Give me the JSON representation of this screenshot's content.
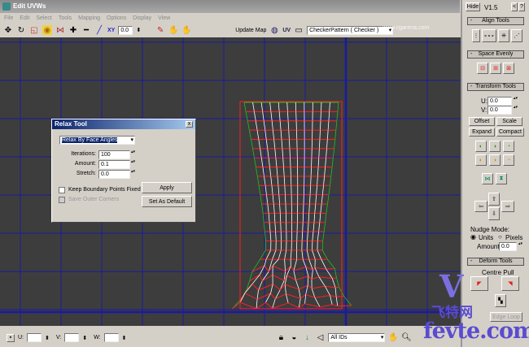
{
  "window": {
    "title": "Edit UVWs"
  },
  "menu": [
    "File",
    "Edit",
    "Select",
    "Tools",
    "Mapping",
    "Options",
    "Display",
    "View"
  ],
  "toolbar": {
    "xy_label": "XY",
    "value": "0.0",
    "update_map": "Update Map",
    "uv_label": "UV",
    "texture": "CheckerPattern  ( Checker )"
  },
  "panel": {
    "hide": "Hide",
    "version": "V1.5",
    "back": "<",
    "help": "?",
    "align_tools": "Align Tools",
    "space_evenly": "Space Evenly",
    "transform_tools": "Transform Tools",
    "u_label": "U:",
    "u_value": "0.0",
    "v_label": "V:",
    "v_value": "0.0",
    "offset": "Offset",
    "scale": "Scale",
    "expand": "Expand",
    "compact": "Compact",
    "nudge_mode": "Nudge Mode:",
    "units": "Units",
    "pixels": "Pixels",
    "amount_label": "Amount:",
    "amount_value": "0.0",
    "deform_tools": "Deform Tools",
    "centre_pull": "Centre Pull",
    "edge_loop": "Edge Loop",
    "collapse": "-"
  },
  "relax": {
    "title": "Relax Tool",
    "close": "x",
    "mode": "Relax By Face Angles",
    "iterations_label": "Iterations:",
    "iterations": "100",
    "amount_label": "Amount:",
    "amount": "0.1",
    "stretch_label": "Stretch:",
    "stretch": "0.0",
    "keep_boundary": "Keep Boundary Points Fixed",
    "save_outer": "Save Outer Corners",
    "apply": "Apply",
    "set_default": "Set As Default"
  },
  "status": {
    "u_label": "U:",
    "v_label": "V:",
    "w_label": "W:",
    "ids": "All IDs"
  },
  "watermark": {
    "site": "www.cgarena.com",
    "brand": "飞特网",
    "url": "fevte.com"
  },
  "colors": {
    "viewport": "#3d3d3d",
    "grid": "#1a1aa0",
    "mesh_red": "#ff2020",
    "mesh_green": "#20c020"
  }
}
